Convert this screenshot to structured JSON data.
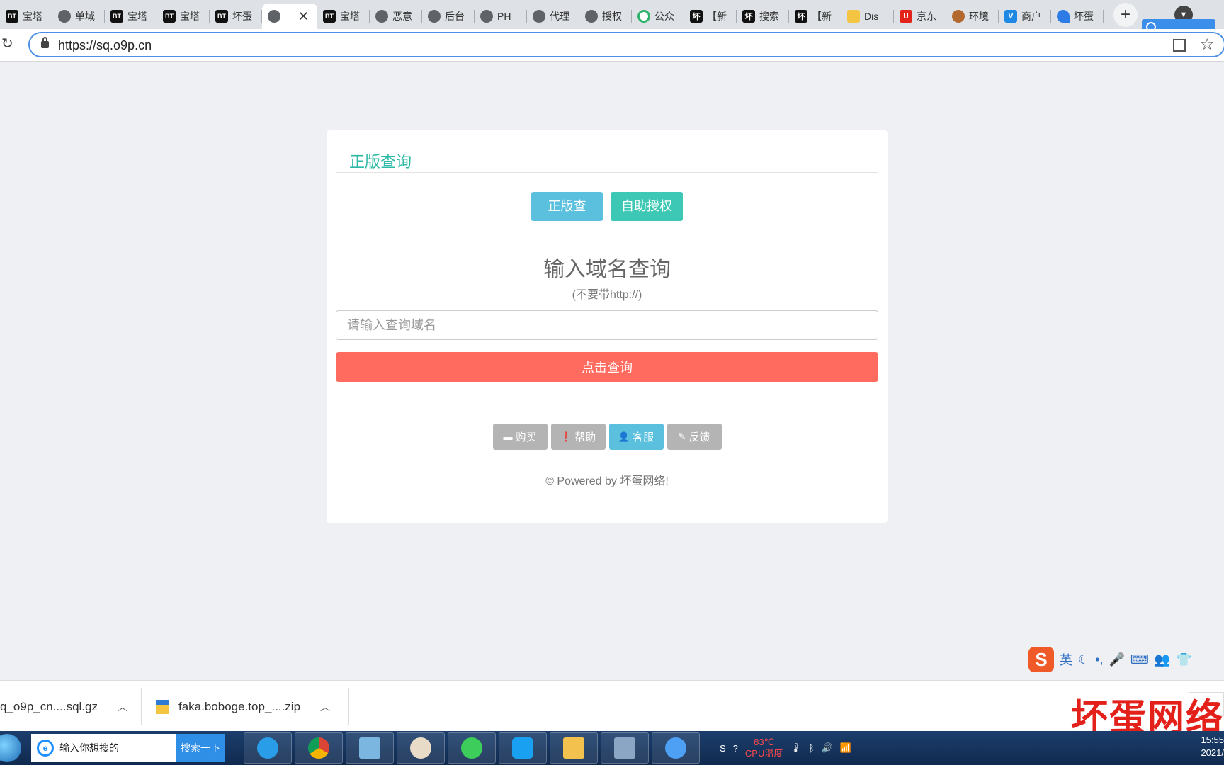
{
  "browser": {
    "tabs": [
      {
        "favicon": "bt",
        "title": "宝塔"
      },
      {
        "favicon": "globe",
        "title": "单域"
      },
      {
        "favicon": "bt",
        "title": "宝塔"
      },
      {
        "favicon": "bt",
        "title": "宝塔"
      },
      {
        "favicon": "bt",
        "title": "坏蛋"
      },
      {
        "favicon": "globe",
        "title": "",
        "active": true
      },
      {
        "favicon": "bt",
        "title": "宝塔"
      },
      {
        "favicon": "globe",
        "title": "恶意"
      },
      {
        "favicon": "globe",
        "title": "后台"
      },
      {
        "favicon": "globe",
        "title": "PH"
      },
      {
        "favicon": "globe",
        "title": "代理"
      },
      {
        "favicon": "globe",
        "title": "授权"
      },
      {
        "favicon": "green",
        "title": "公众"
      },
      {
        "favicon": "bad",
        "title": "【新"
      },
      {
        "favicon": "bad",
        "title": "搜索"
      },
      {
        "favicon": "bad",
        "title": "【新"
      },
      {
        "favicon": "yellow",
        "title": "Dis"
      },
      {
        "favicon": "red",
        "title": "京东"
      },
      {
        "favicon": "brown",
        "title": "环境"
      },
      {
        "favicon": "blue",
        "title": "商户"
      },
      {
        "favicon": "wave",
        "title": "坏蛋"
      }
    ],
    "close_glyph": "✕",
    "new_tab_glyph": "+",
    "url": "https://sq.o9p.cn"
  },
  "page": {
    "section_title": "正版查询",
    "tab_buttons": {
      "query": "正版查询",
      "self_auth": "自助授权"
    },
    "heading": "输入域名查询",
    "hint": "(不要带http://)",
    "input": {
      "placeholder": "请输入查询域名",
      "value": ""
    },
    "submit_label": "点击查询",
    "footer_buttons": [
      {
        "icon": "credit-card-icon",
        "glyph": "▬",
        "label": "购买"
      },
      {
        "icon": "exclamation-icon",
        "glyph": "❗",
        "label": "帮助"
      },
      {
        "icon": "user-icon",
        "glyph": "👤",
        "label": "客服"
      },
      {
        "icon": "pencil-icon",
        "glyph": "✎",
        "label": "反馈"
      }
    ],
    "powered_by": "© Powered by 坏蛋网络!"
  },
  "ime": {
    "logo": "S",
    "mode": "英"
  },
  "downloads": [
    {
      "name": "q_o9p_cn....sql.gz"
    },
    {
      "name": "faka.boboge.top_....zip"
    }
  ],
  "watermark": "坏蛋网络",
  "taskbar": {
    "search_placeholder": "输入你想搜的",
    "search_button": "搜索一下",
    "cpu_temp": "83℃",
    "cpu_label": "CPU温度",
    "time": "15:55",
    "date": "2021/"
  },
  "colors": {
    "accent_teal": "#2bb8a4",
    "info_blue": "#5bc0de",
    "primary_teal": "#3cc8b4",
    "submit_red": "#ff6b5e",
    "muted_gray": "#b4b4b4"
  }
}
